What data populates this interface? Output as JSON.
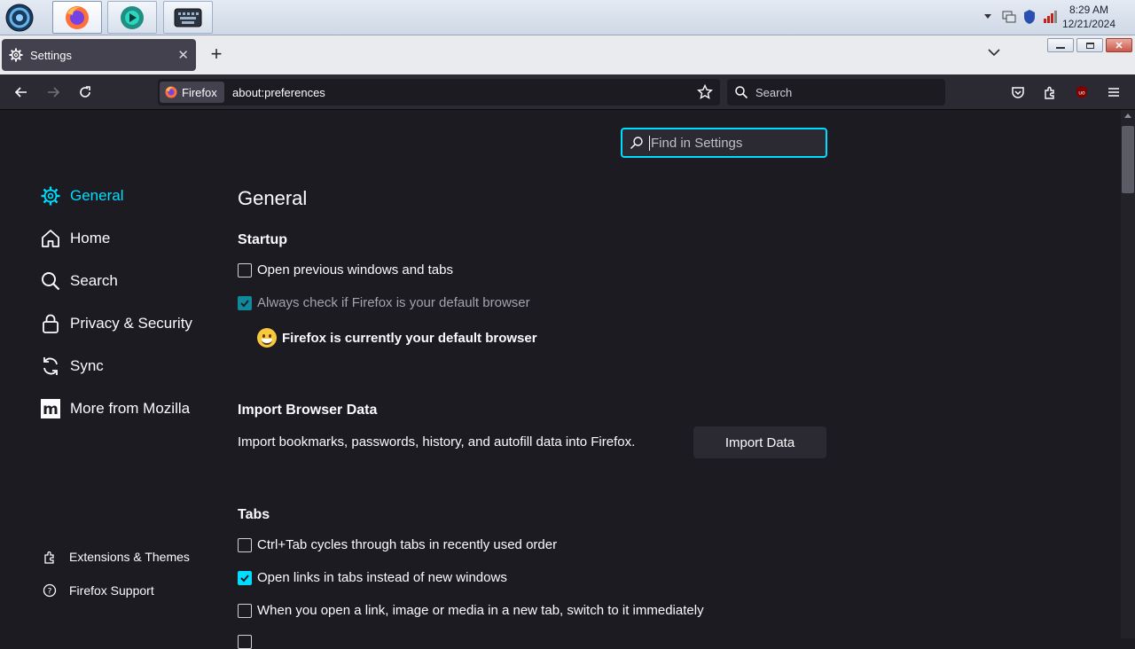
{
  "taskbar": {
    "clock_time": "8:29 AM",
    "clock_date": "12/21/2024"
  },
  "tab": {
    "title": "Settings"
  },
  "navbar": {
    "identity_label": "Firefox",
    "url": "about:preferences",
    "search_placeholder": "Search"
  },
  "find": {
    "placeholder": "Find in Settings"
  },
  "categories": {
    "general": "General",
    "home": "Home",
    "search": "Search",
    "privacy": "Privacy & Security",
    "sync": "Sync",
    "mozilla": "More from Mozilla"
  },
  "footer": {
    "extensions": "Extensions & Themes",
    "support": "Firefox Support"
  },
  "main": {
    "heading": "General",
    "startup": {
      "heading": "Startup",
      "open_previous": "Open previous windows and tabs",
      "open_previous_checked": false,
      "always_check": "Always check if Firefox is your default browser",
      "always_check_checked": true,
      "default_msg": "Firefox is currently your default browser"
    },
    "import": {
      "heading": "Import Browser Data",
      "description": "Import bookmarks, passwords, history, and autofill data into Firefox.",
      "button": "Import Data"
    },
    "tabs": {
      "heading": "Tabs",
      "ctrl_tab": "Ctrl+Tab cycles through tabs in recently used order",
      "ctrl_tab_checked": false,
      "open_links": "Open links in tabs instead of new windows",
      "open_links_checked": true,
      "switch_new": "When you open a link, image or media in a new tab, switch to it immediately",
      "switch_new_checked": false
    }
  },
  "colors": {
    "accent": "#00ddff",
    "background": "#1c1b22",
    "toolbar": "#2b2a33"
  }
}
